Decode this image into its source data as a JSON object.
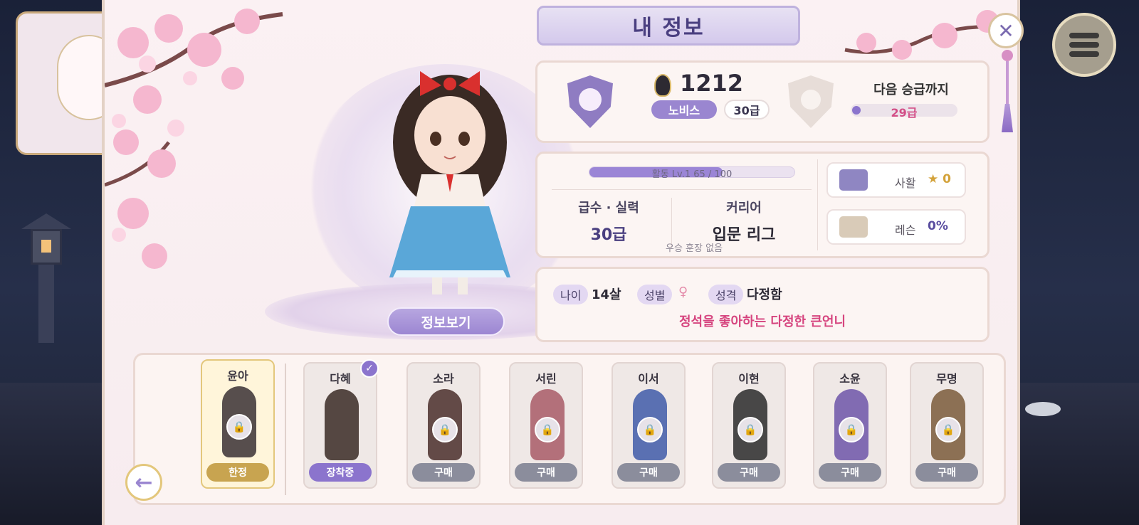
{
  "title": "내 정보",
  "rank": {
    "score": "1212",
    "tier": "노비스",
    "grade": "30급",
    "next_label": "다음 승급까지",
    "next_value": "29급",
    "next_progress": 0.08
  },
  "stats": {
    "activity_text": "활동 Lv.1  65 / 100",
    "activity_progress": 0.65,
    "skill_label": "급수 · 실력",
    "skill_value": "30급",
    "career_label": "커리어",
    "career_value": "입문 리그",
    "no_win_text": "우승 훈장 없음",
    "book_label": "사활",
    "book_value": "0",
    "lesson_label": "레슨",
    "lesson_value": "0%"
  },
  "profile": {
    "age_label": "나이",
    "age_value": "14살",
    "gender_label": "성별",
    "gender_symbol": "♀",
    "personality_label": "성격",
    "personality_value": "다정함",
    "quote": "정석을 좋아하는 다정한 큰언니"
  },
  "info_button": "정보보기",
  "roster": [
    {
      "name": "윤아",
      "button": "한정",
      "state": "limited"
    },
    {
      "name": "다혜",
      "button": "장착중",
      "state": "equipped"
    },
    {
      "name": "소라",
      "button": "구매",
      "state": "locked"
    },
    {
      "name": "서린",
      "button": "구매",
      "state": "locked"
    },
    {
      "name": "이서",
      "button": "구매",
      "state": "locked"
    },
    {
      "name": "이현",
      "button": "구매",
      "state": "locked"
    },
    {
      "name": "소윤",
      "button": "구매",
      "state": "locked"
    },
    {
      "name": "무명",
      "button": "구매",
      "state": "locked"
    }
  ],
  "colors": {
    "accent": "#8b74cd",
    "pink_text": "#d6457f",
    "gold": "#c8a450"
  }
}
